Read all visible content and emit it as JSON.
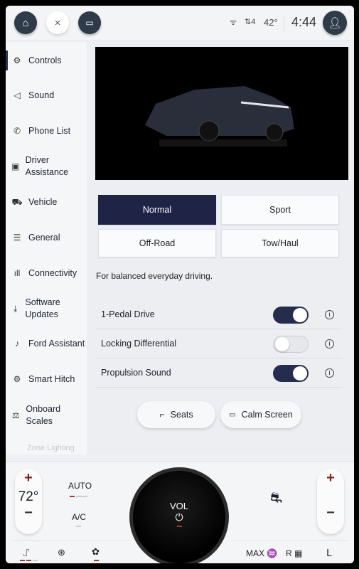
{
  "topbar": {
    "close": "×",
    "signal": "ᯤ",
    "connectivity": "⇅4",
    "temp": "42°",
    "time": "4:44"
  },
  "sidebar": {
    "items": [
      {
        "label": "Controls",
        "icon": "controls-icon",
        "glyph": "⚙"
      },
      {
        "label": "Sound",
        "icon": "speaker-icon",
        "glyph": "◁"
      },
      {
        "label": "Phone List",
        "icon": "phone-icon",
        "glyph": "✆"
      },
      {
        "label": "Driver Assistance",
        "icon": "driver-assist-icon",
        "glyph": "▣"
      },
      {
        "label": "Vehicle",
        "icon": "vehicle-icon",
        "glyph": "⛟"
      },
      {
        "label": "General",
        "icon": "sliders-icon",
        "glyph": "☰"
      },
      {
        "label": "Connectivity",
        "icon": "signal-bars-icon",
        "glyph": "ıll"
      },
      {
        "label": "Software Updates",
        "icon": "download-icon",
        "glyph": "⤓"
      },
      {
        "label": "Ford Assistant",
        "icon": "assistant-icon",
        "glyph": "♪"
      },
      {
        "label": "Smart Hitch",
        "icon": "hitch-icon",
        "glyph": "⚙"
      },
      {
        "label": "Onboard Scales",
        "icon": "scales-icon",
        "glyph": "⚖"
      }
    ],
    "partial": "Zone Lighting"
  },
  "modes": [
    {
      "label": "Normal",
      "selected": true
    },
    {
      "label": "Sport"
    },
    {
      "label": "Off-Road"
    },
    {
      "label": "Tow/Haul"
    }
  ],
  "description": "For balanced everyday driving.",
  "toggles": [
    {
      "label": "1-Pedal Drive",
      "on": true
    },
    {
      "label": "Locking Differential",
      "on": false
    },
    {
      "label": "Propulsion Sound",
      "on": true
    }
  ],
  "actions": {
    "seats": "Seats",
    "calm": "Calm Screen"
  },
  "climate": {
    "plus": "+",
    "minus": "−",
    "temp": "72°",
    "auto": "AUTO",
    "ac": "A/C",
    "vol": "VOL",
    "power": "⏻",
    "max": "MAX",
    "rear": "R"
  },
  "colors": {
    "accent": "#1f2447",
    "indicator": "#b0322a"
  }
}
